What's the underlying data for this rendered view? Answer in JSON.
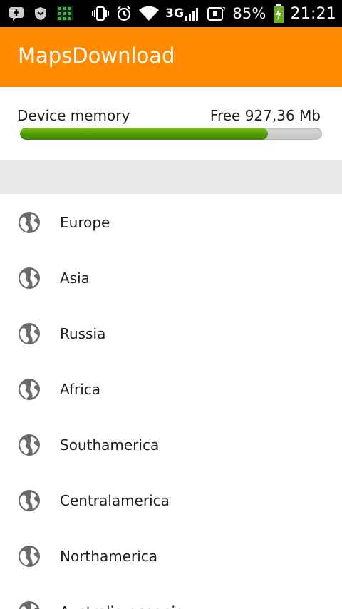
{
  "status_bar": {
    "icons_left": [
      "bbm-icon",
      "shield-icon",
      "grid-app-icon"
    ],
    "icons_right": [
      "vibrate-icon",
      "alarm-icon",
      "wifi-icon",
      "signal-3g-icon",
      "sim2-icon",
      "battery-charging-icon"
    ],
    "network": "3G",
    "battery_percent": "85%",
    "time": "21:21"
  },
  "app_bar": {
    "title": "MapsDownload",
    "color": "#ff8a00"
  },
  "memory": {
    "label": "Device memory",
    "free_text": "Free 927,36 Mb",
    "used_fraction": 0.82,
    "bar_color": "#4e9a05"
  },
  "regions": [
    {
      "label": "Europe",
      "icon": "globe-icon"
    },
    {
      "label": "Asia",
      "icon": "globe-icon"
    },
    {
      "label": "Russia",
      "icon": "globe-icon"
    },
    {
      "label": "Africa",
      "icon": "globe-icon"
    },
    {
      "label": "Southamerica",
      "icon": "globe-icon"
    },
    {
      "label": "Centralamerica",
      "icon": "globe-icon"
    },
    {
      "label": "Northamerica",
      "icon": "globe-icon"
    },
    {
      "label": "Australia-oceania",
      "icon": "globe-icon"
    }
  ]
}
